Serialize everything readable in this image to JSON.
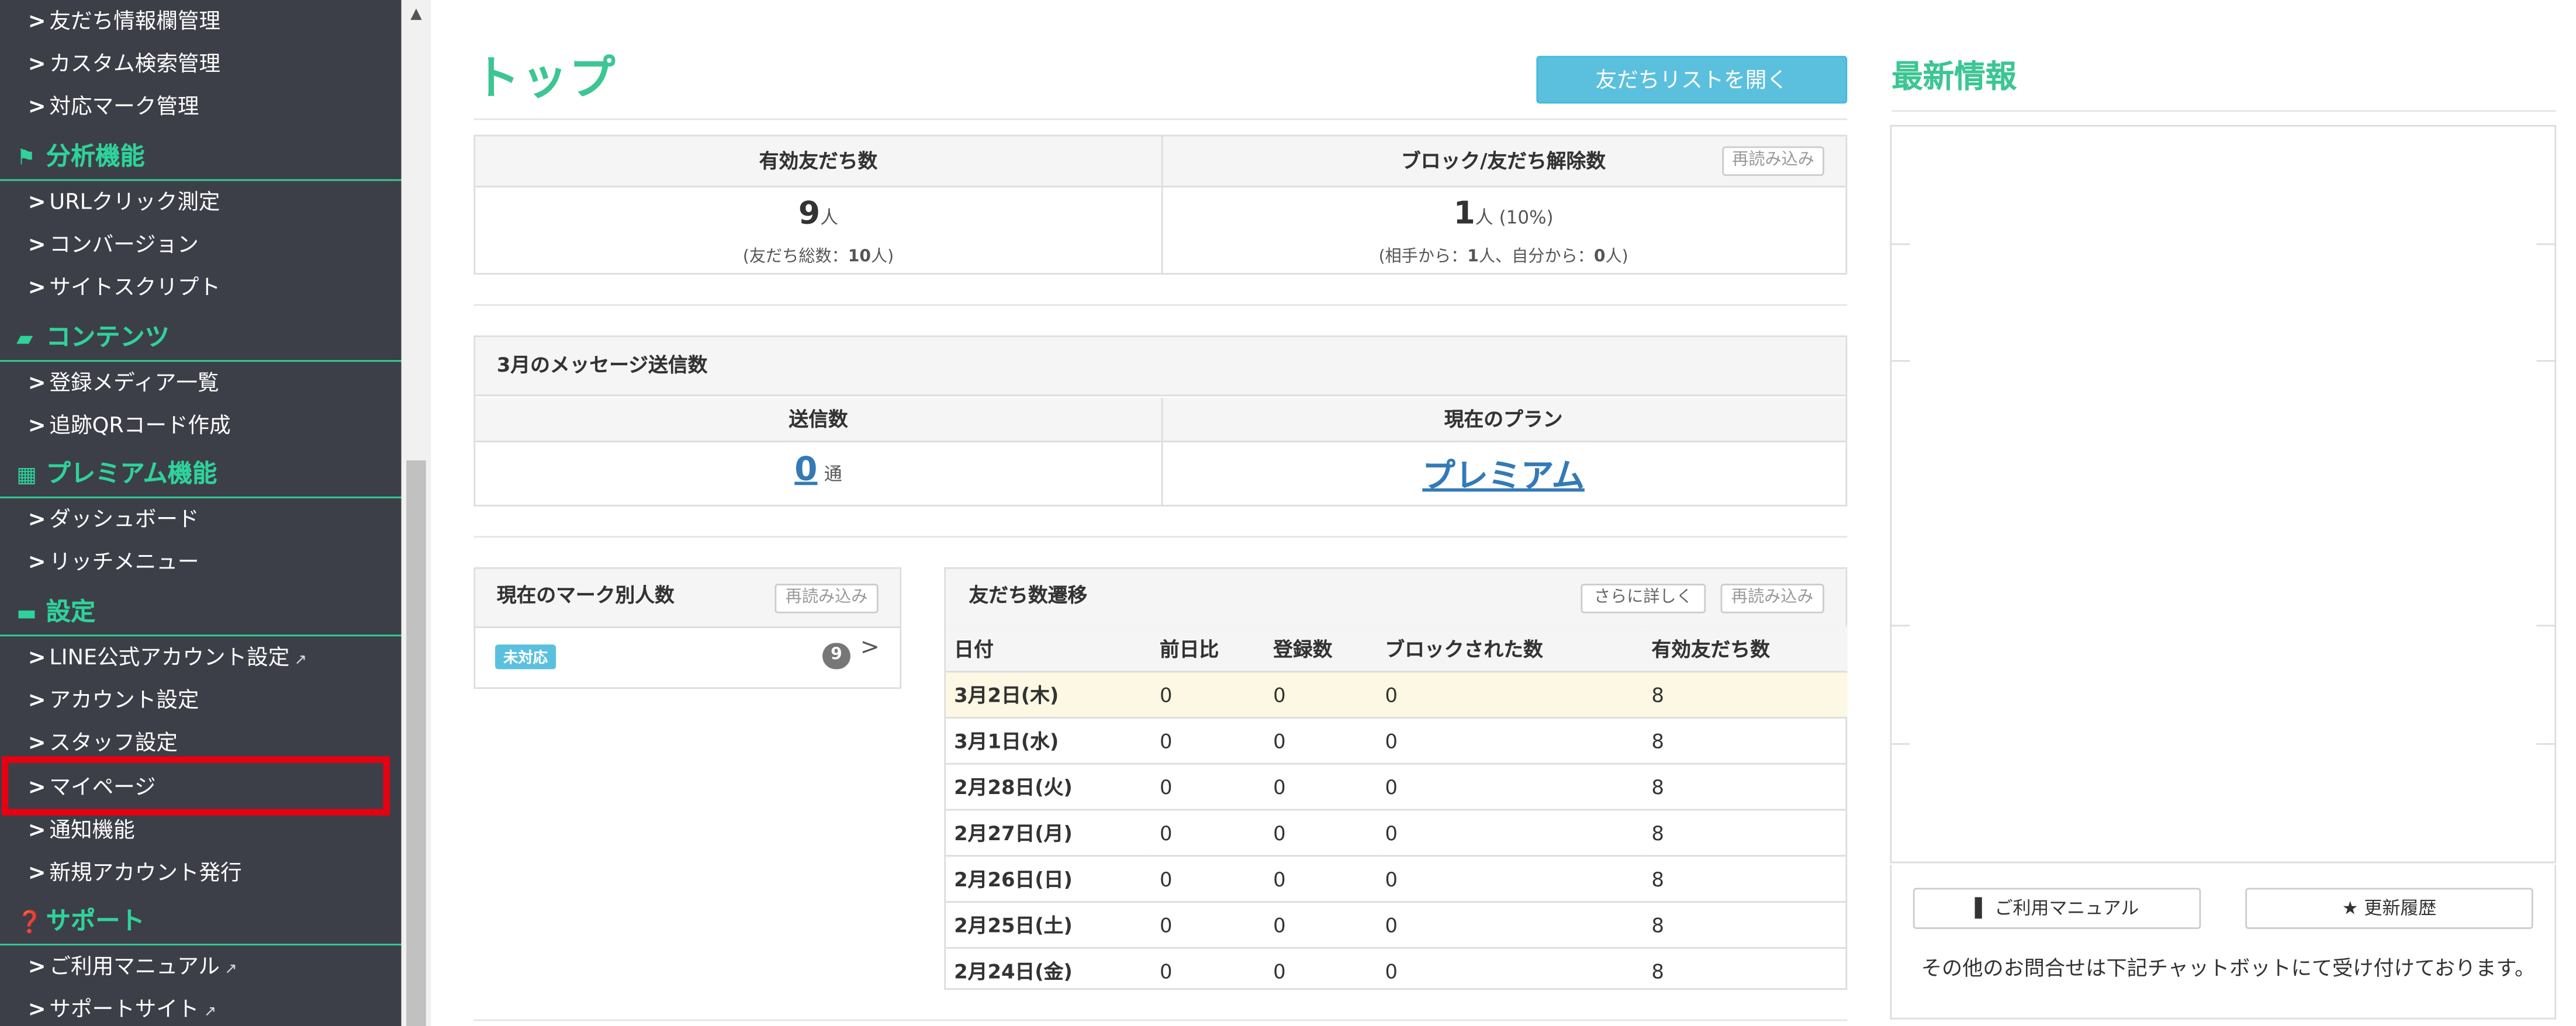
{
  "sidebar": {
    "items_top": [
      {
        "label": "友だち情報欄管理"
      },
      {
        "label": "カスタム検索管理"
      },
      {
        "label": "対応マーク管理"
      }
    ],
    "sections": [
      {
        "title": "分析機能",
        "icon": "flag-icon",
        "items": [
          {
            "label": "URLクリック測定"
          },
          {
            "label": "コンバージョン"
          },
          {
            "label": "サイトスクリプト"
          }
        ]
      },
      {
        "title": "コンテンツ",
        "icon": "folder-icon",
        "items": [
          {
            "label": "登録メディア一覧"
          },
          {
            "label": "追跡QRコード作成"
          }
        ]
      },
      {
        "title": "プレミアム機能",
        "icon": "gift-icon",
        "items": [
          {
            "label": "ダッシュボード"
          },
          {
            "label": "リッチメニュー"
          }
        ]
      },
      {
        "title": "設定",
        "icon": "chat-icon",
        "items": [
          {
            "label": "LINE公式アカウント設定"
          },
          {
            "label": "アカウント設定"
          },
          {
            "label": "スタッフ設定"
          },
          {
            "label": "マイページ"
          },
          {
            "label": "通知機能"
          },
          {
            "label": "新規アカウント発行"
          }
        ]
      },
      {
        "title": "サポート",
        "icon": "question-icon",
        "items": [
          {
            "label": "ご利用マニュアル"
          },
          {
            "label": "サポートサイト"
          }
        ]
      }
    ]
  },
  "main": {
    "title": "トップ",
    "open_friend_list_button": "友だちリストを開く",
    "reload_label": "再読み込み",
    "friends": {
      "valid_label": "有効友だち数",
      "valid_count": "9",
      "unit": "人",
      "total_note_prefix": "(友だち総数：",
      "total_note_value": "10",
      "total_note_suffix": "人)",
      "block_label": "ブロック/友だち解除数",
      "block_count": "1",
      "block_pct": "人 (10%)",
      "block_note_a": "(相手から：",
      "block_note_a_val": "1",
      "block_note_mid": "人、自分から：",
      "block_note_b_val": "0",
      "block_note_end": "人)"
    },
    "messages": {
      "title": "3月のメッセージ送信数",
      "sent_label": "送信数",
      "sent_count": "0",
      "sent_unit": "通",
      "plan_label": "現在のプラン",
      "plan_value": "プレミアム"
    },
    "marks": {
      "title": "現在のマーク別人数",
      "badge": "未対応",
      "count": "9"
    },
    "trend": {
      "title": "友だち数遷移",
      "more_button": "さらに詳しく",
      "headers": [
        "日付",
        "前日比",
        "登録数",
        "ブロックされた数",
        "有効友だち数"
      ],
      "rows": [
        [
          "3月2日(木)",
          "0",
          "0",
          "0",
          "8"
        ],
        [
          "3月1日(水)",
          "0",
          "0",
          "0",
          "8"
        ],
        [
          "2月28日(火)",
          "0",
          "0",
          "0",
          "8"
        ],
        [
          "2月27日(月)",
          "0",
          "0",
          "0",
          "8"
        ],
        [
          "2月26日(日)",
          "0",
          "0",
          "0",
          "8"
        ],
        [
          "2月25日(土)",
          "0",
          "0",
          "0",
          "8"
        ],
        [
          "2月24日(金)",
          "0",
          "0",
          "0",
          "8"
        ]
      ]
    }
  },
  "news": {
    "title": "最新情報",
    "manual_button": "ご利用マニュアル",
    "history_button": "更新履歴",
    "contact_text": "その他のお問合せは下記チャットボットにて受け付けております。"
  },
  "colors": {
    "accent": "#3cc693",
    "sidebar_bg": "#3d3f48",
    "sidebar_heading": "#2fd29a",
    "button_info": "#5bc0de",
    "highlight": "#e60012"
  }
}
